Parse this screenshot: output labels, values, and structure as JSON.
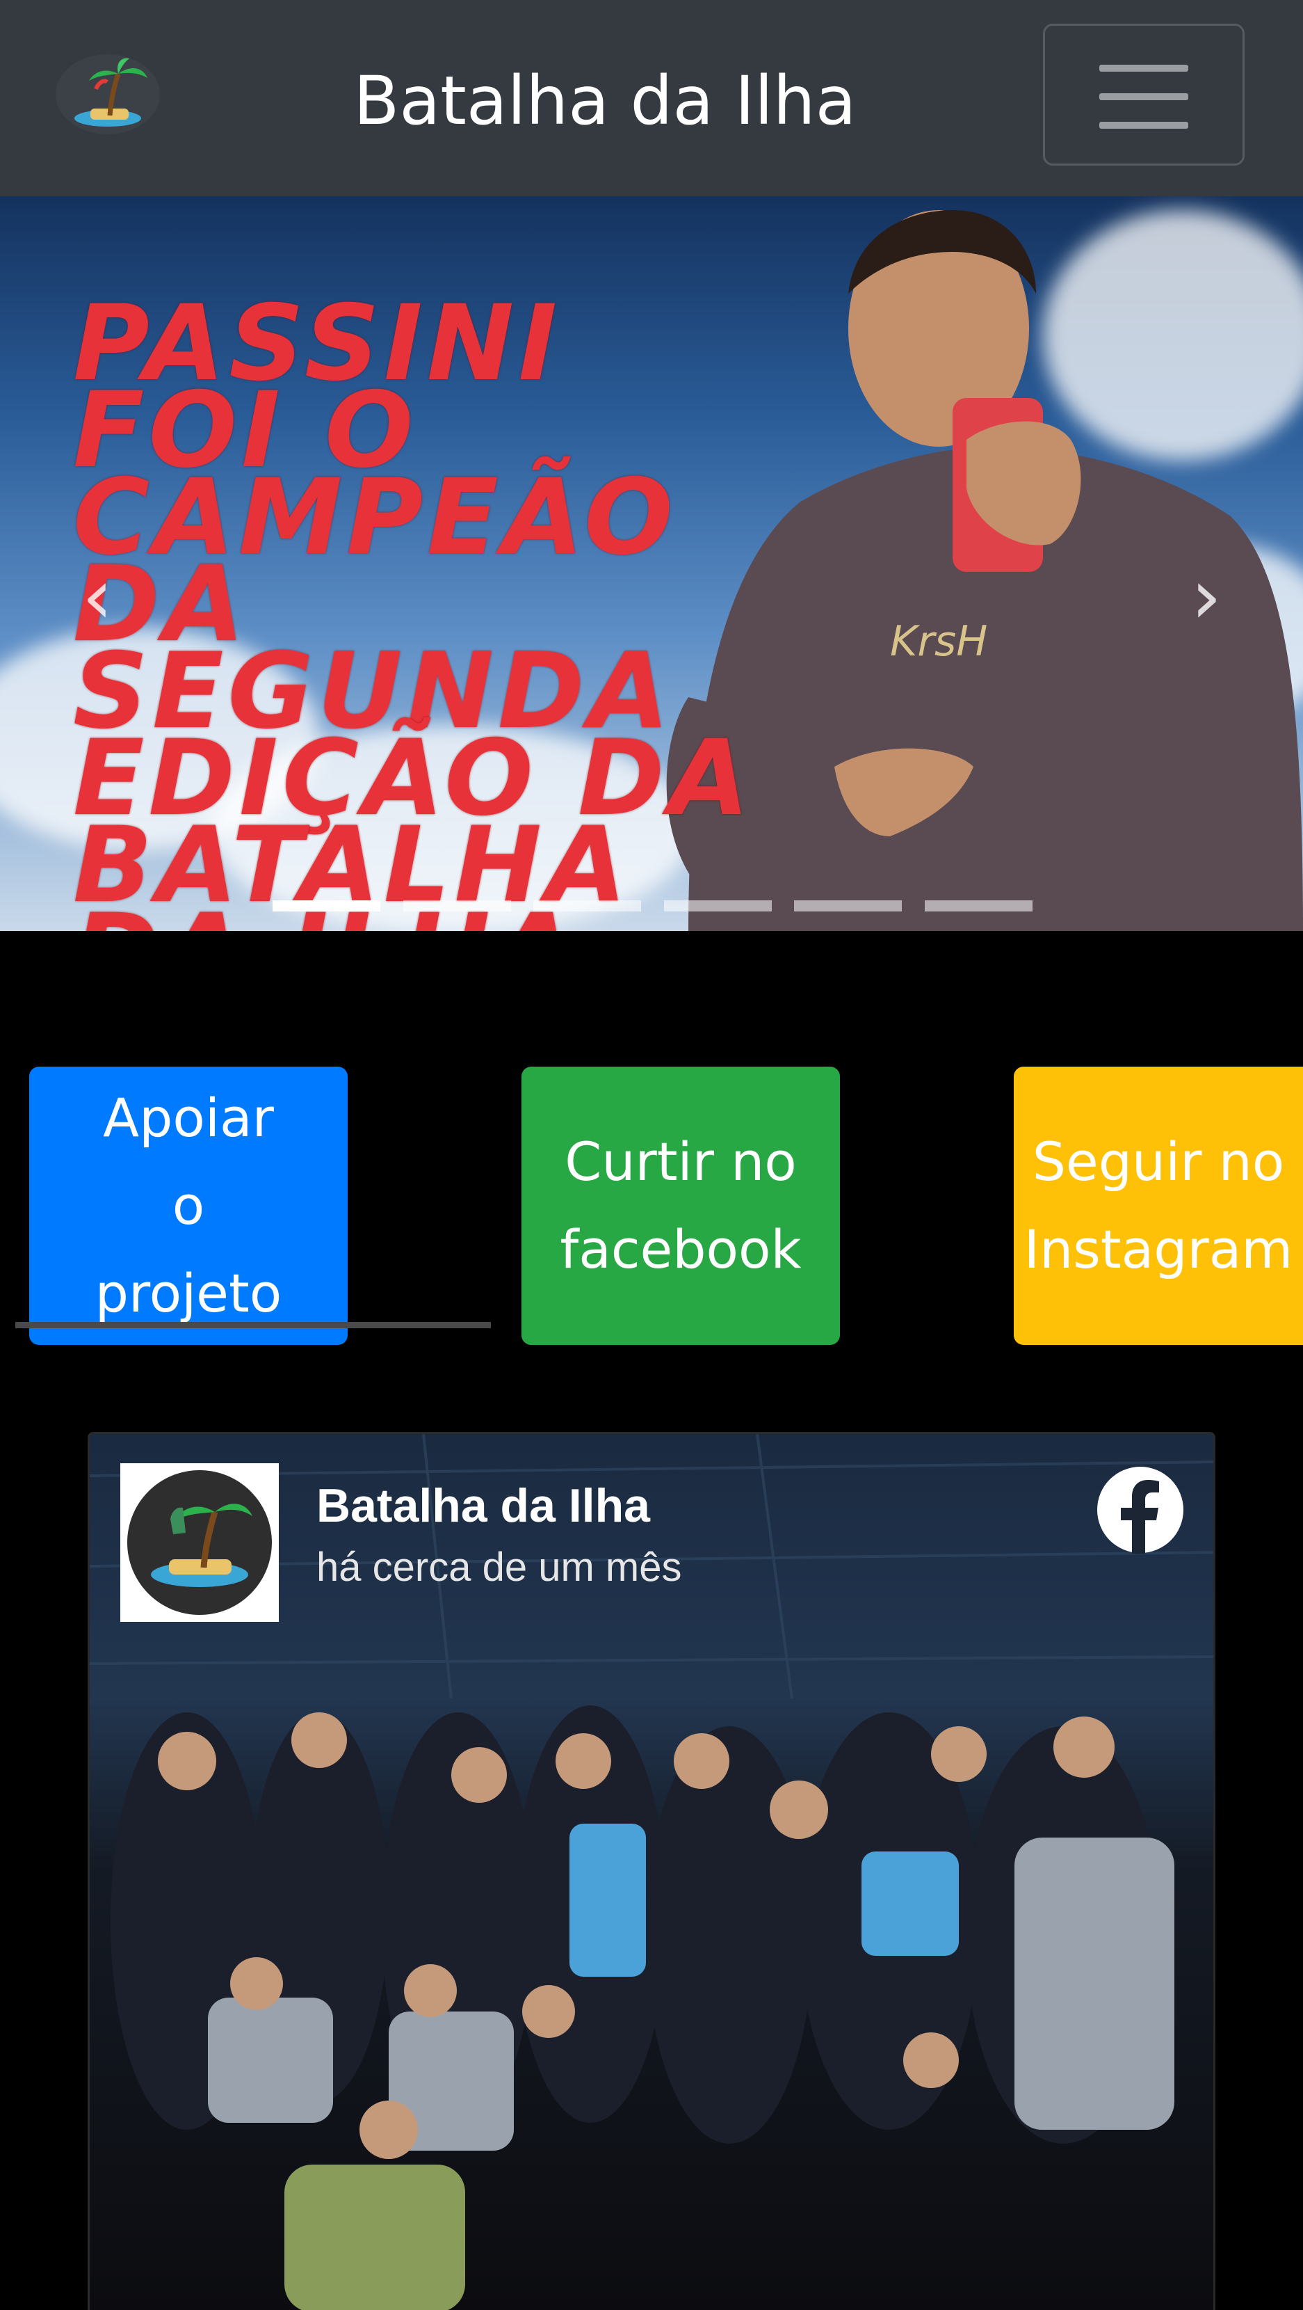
{
  "navbar": {
    "brand_title": "Batalha da Ilha",
    "logo_icon": "palm-island-logo-icon",
    "toggler_icon": "hamburger-menu-icon",
    "background": "#343a40"
  },
  "carousel": {
    "headline": "PASSINI FOI O CAMPEÃO DA SEGUNDA EDIÇÃO DA BATALHA DA ILHA",
    "headline_color": "#e8323a",
    "prev_icon": "chevron-left-icon",
    "next_icon": "chevron-right-icon",
    "prev_glyph": "‹",
    "next_glyph": "›",
    "slide_count": 6,
    "active_slide": 1
  },
  "actions": {
    "support_label": "Apoiar o projeto",
    "facebook_label": "Curtir no facebook",
    "instagram_label": "Seguir no Instagram",
    "colors": {
      "support": "#007bff",
      "facebook": "#28a745",
      "instagram": "#ffc107"
    }
  },
  "facebook_post": {
    "page_name": "Batalha da Ilha",
    "posted_time": "há cerca de um mês",
    "icon": "facebook-icon"
  }
}
